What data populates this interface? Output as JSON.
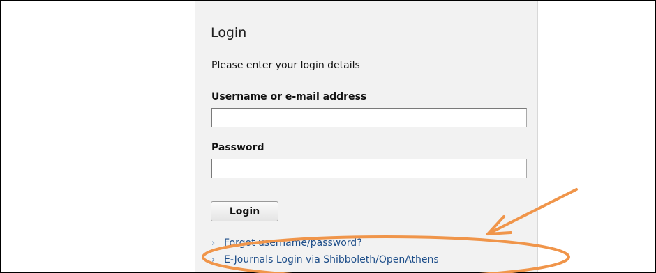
{
  "login": {
    "title": "Login",
    "intro": "Please enter your login details",
    "username_label": "Username or e-mail address",
    "username_value": "",
    "password_label": "Password",
    "password_value": "",
    "button_label": "Login"
  },
  "links": [
    {
      "label": "Forgot username/password?",
      "icon": "chevron-right-icon"
    },
    {
      "label": "E-Journals Login via Shibboleth/OpenAthens",
      "icon": "chevron-right-icon"
    }
  ],
  "annotation": {
    "color": "#f0954a",
    "shapes": [
      "arrow",
      "ellipse"
    ]
  },
  "colors": {
    "panel_background": "#f2f2f2",
    "link": "#1f4f8a"
  }
}
